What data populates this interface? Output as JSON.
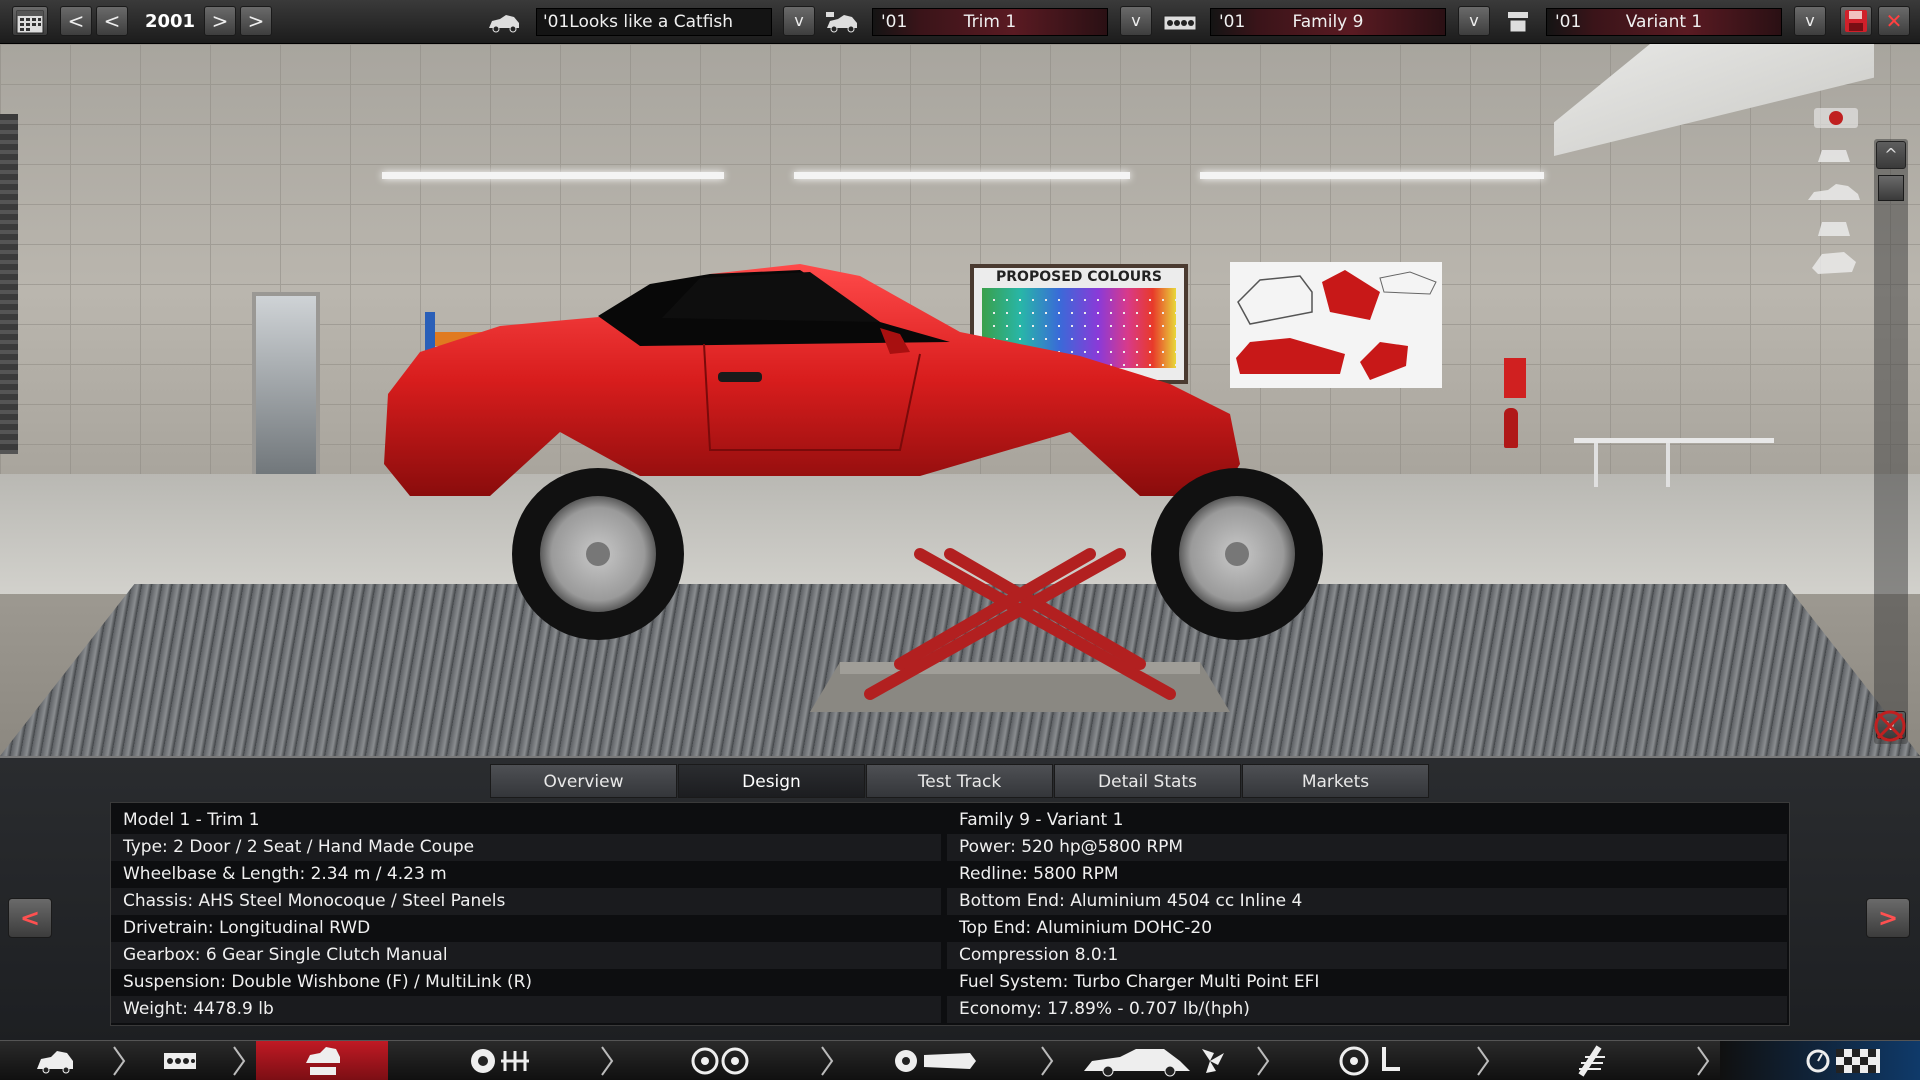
{
  "topbar": {
    "calendar_icon": "calendar-icon",
    "year": "2001",
    "model": {
      "prefix": "",
      "name": "'01Looks like a Catfish"
    },
    "trim": {
      "prefix": "'01",
      "name": "Trim 1"
    },
    "family": {
      "prefix": "'01",
      "name": "Family 9"
    },
    "variant": {
      "prefix": "'01",
      "name": "Variant 1"
    },
    "dropdown_glyph": "v",
    "save_icon": "save-icon",
    "close_glyph": "✕"
  },
  "scene": {
    "poster_title": "PROPOSED COLOURS",
    "car_color": "#d81d1d"
  },
  "slider": {
    "up_glyph": "^",
    "down_glyph": "v"
  },
  "tabs": [
    {
      "label": "Overview",
      "active": false
    },
    {
      "label": "Design",
      "active": true
    },
    {
      "label": "Test Track",
      "active": false
    },
    {
      "label": "Detail Stats",
      "active": false
    },
    {
      "label": "Markets",
      "active": false
    }
  ],
  "stats": {
    "left": [
      "Model 1 - Trim 1",
      "Type: 2 Door / 2 Seat / Hand Made Coupe",
      "Wheelbase & Length: 2.34 m / 4.23 m",
      "Chassis: AHS Steel Monocoque / Steel Panels",
      "Drivetrain: Longitudinal RWD",
      "Gearbox: 6 Gear Single Clutch Manual",
      "Suspension: Double Wishbone (F) / MultiLink (R)",
      "Weight: 4478.9 lb"
    ],
    "right": [
      "Family 9 - Variant 1",
      "Power: 520 hp@5800 RPM",
      "Redline: 5800 RPM",
      "Bottom End: Aluminium 4504 cc Inline 4",
      "Top End: Aluminium DOHC-20",
      "Compression 8.0:1",
      "Fuel System: Turbo Charger Multi Point EFI",
      "Economy: 17.89% - 0.707 lb/(hph)"
    ]
  },
  "nav": {
    "prev_glyph": "<",
    "next_glyph": ">"
  },
  "stages": [
    {
      "icon": "car-model-icon",
      "active": false
    },
    {
      "icon": "trim-grille-icon",
      "active": false
    },
    {
      "icon": "car-body-lift-icon",
      "active": true
    },
    {
      "icon": "engine-block-icon",
      "active": false
    },
    {
      "icon": "engine-parts-icon",
      "active": false
    },
    {
      "icon": "turbo-exhaust-icon",
      "active": false
    },
    {
      "icon": "car-aero-icon",
      "active": false
    },
    {
      "icon": "interior-icon",
      "active": false
    },
    {
      "icon": "suspension-icon",
      "active": false
    },
    {
      "icon": "test-track-icon",
      "active": false
    }
  ],
  "colors": {
    "accent_red": "#c01a24",
    "panel_bg": "#0d0e10"
  }
}
